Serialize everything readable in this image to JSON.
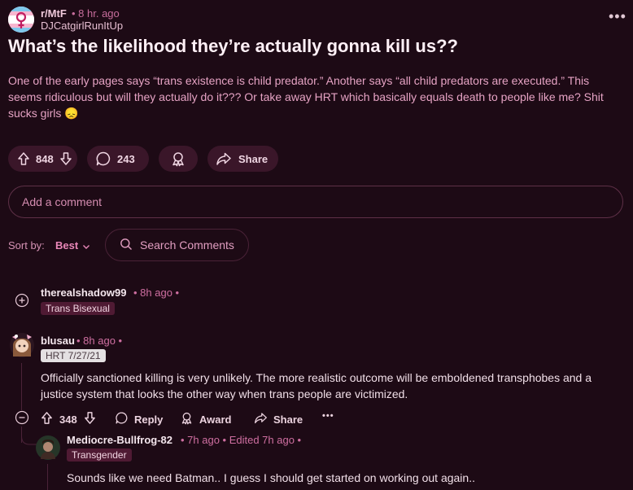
{
  "post": {
    "subreddit": "r/MtF",
    "time": "• 8 hr. ago",
    "author": "DJCatgirlRunItUp",
    "title": "What’s the likelihood they’re actually gonna kill us??",
    "body": "One of the early pages says “trans existence is child predator.” Another says “all child predators are executed.” This seems ridiculous but will they actually do it??? Or take away HRT which basically equals death to people like me? Shit sucks girls 😞",
    "votes": "848",
    "comments": "243",
    "share_label": "Share",
    "more_label": "•••"
  },
  "add_comment_placeholder": "Add a comment",
  "sort": {
    "label": "Sort by:",
    "value": "Best",
    "search_placeholder": "Search Comments"
  },
  "comments": [
    {
      "username": "therealshadow99",
      "meta": "• 8h ago •",
      "flair": "Trans Bisexual"
    },
    {
      "username": "blusau",
      "meta": "• 8h ago •",
      "flair": "HRT 7/27/21",
      "body": "Officially sanctioned killing is very unlikely. The more realistic outcome will be emboldened transphobes and a justice system that looks the other way when trans people are victimized.",
      "votes": "348",
      "reply_label": "Reply",
      "award_label": "Award",
      "share_label": "Share",
      "more_label": "•••"
    },
    {
      "username": "Mediocre-Bullfrog-82",
      "meta": "• 7h ago • Edited 7h ago •",
      "flair": "Transgender",
      "body": "Sounds like we need Batman.. I guess I should get started on working out again.."
    }
  ],
  "colors": {
    "background": "#1d0a15",
    "pill": "#3a1629",
    "accent": "#e986b7",
    "flair_dark": "#4f1a33"
  },
  "icons": [
    "trans-symbol-icon",
    "upvote-icon",
    "downvote-icon",
    "comment-icon",
    "award-icon",
    "share-icon",
    "chevron-down-icon",
    "search-icon",
    "expand-icon",
    "collapse-icon",
    "more-icon"
  ]
}
